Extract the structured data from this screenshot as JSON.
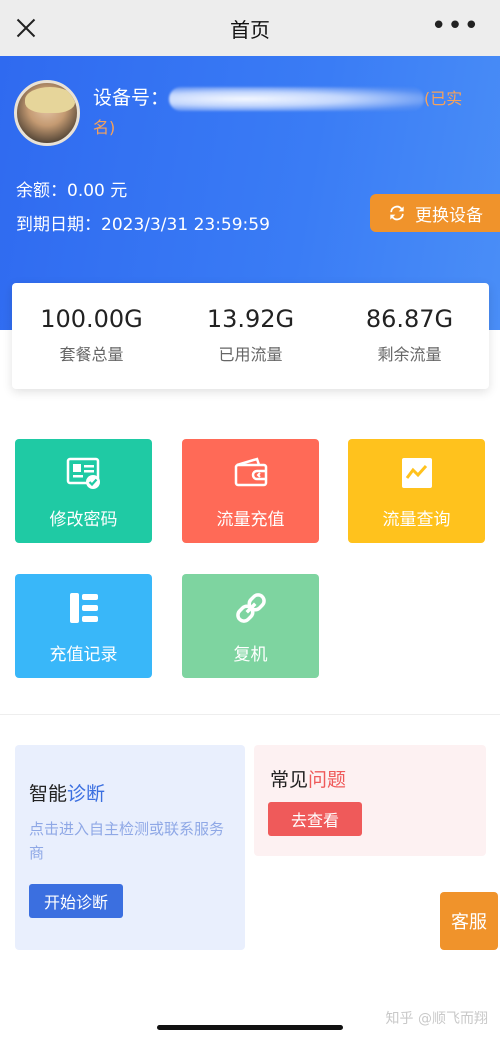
{
  "nav": {
    "title": "首页",
    "more": "•••"
  },
  "header": {
    "device_label": "设备号：",
    "device_tag": "(已实名)",
    "balance": "余额：0.00 元",
    "expire": "到期日期：2023/3/31 23:59:59",
    "switch_button": "更换设备"
  },
  "stats": [
    {
      "value": "100.00G",
      "label": "套餐总量"
    },
    {
      "value": "13.92G",
      "label": "已用流量"
    },
    {
      "value": "86.87G",
      "label": "剩余流量"
    }
  ],
  "tiles": [
    {
      "label": "修改密码",
      "icon": "id-card-check-icon",
      "color": "#1fcaa4"
    },
    {
      "label": "流量充值",
      "icon": "wallet-icon",
      "color": "#ff6a57"
    },
    {
      "label": "流量查询",
      "icon": "line-chart-icon",
      "color": "#ffc21d"
    },
    {
      "label": "充值记录",
      "icon": "record-list-icon",
      "color": "#39b7f9"
    },
    {
      "label": "复机",
      "icon": "link-icon",
      "color": "#7ed4a0"
    }
  ],
  "diagnosis": {
    "title_prefix": "智能",
    "title_highlight": "诊断",
    "desc": "点击进入自主检测或联系服务商",
    "button": "开始诊断"
  },
  "faq": {
    "title_prefix": "常见",
    "title_highlight": "问题",
    "button": "去查看"
  },
  "service_button": "客服",
  "watermark": "知乎 @顺飞而翔",
  "colors": {
    "primary": "#3a7cf5",
    "accent": "#f0932b"
  }
}
